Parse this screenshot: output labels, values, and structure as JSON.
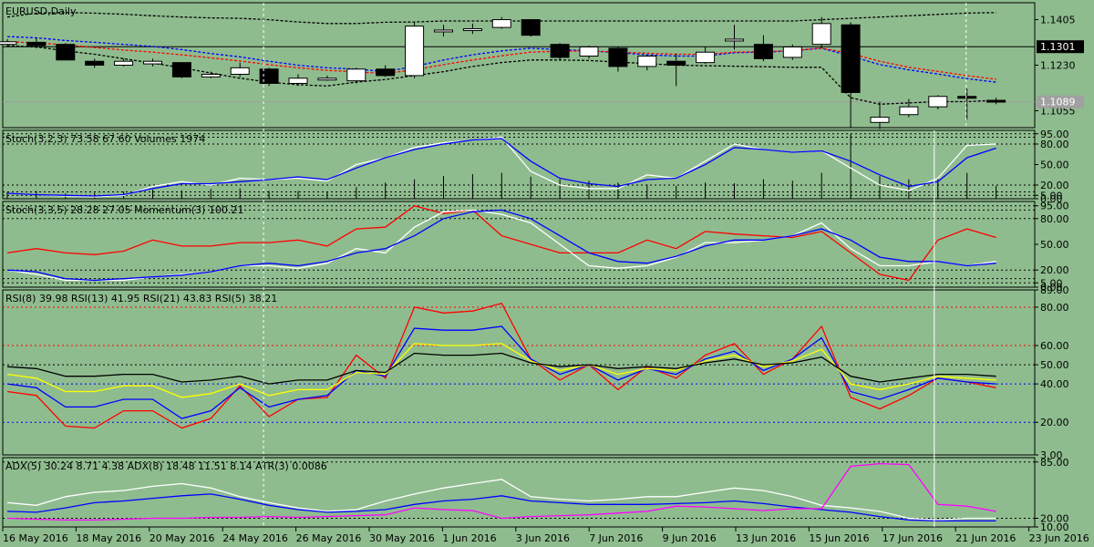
{
  "colors": {
    "background": "#8fbc8f",
    "bull_candle": "#ffffff",
    "bear_candle": "#000000",
    "blue": "#0000ff",
    "red": "#ff0000",
    "white": "#ffffff",
    "yellow": "#ffff00",
    "magenta": "#ff00ff",
    "grid_line": "#000000",
    "price_label_bg": "#000000",
    "bid_label_bg": "#a0a0a0"
  },
  "chart_data": [
    {
      "type": "candlestick",
      "title": "EURUSD,Daily",
      "y_ticks": [
        "1.1405",
        "1.1230",
        "1.1055"
      ],
      "ylim": [
        1.099,
        1.147
      ],
      "hline_label": "1.1301",
      "hline_value": 1.1301,
      "bid_label": "1.1089",
      "bid_value": 1.1089,
      "candles": [
        {
          "o": 1.131,
          "h": 1.133,
          "l": 1.13,
          "c": 1.132
        },
        {
          "o": 1.1318,
          "h": 1.1335,
          "l": 1.1295,
          "c": 1.1305
        },
        {
          "o": 1.131,
          "h": 1.1315,
          "l": 1.125,
          "c": 1.125
        },
        {
          "o": 1.1245,
          "h": 1.1255,
          "l": 1.122,
          "c": 1.123
        },
        {
          "o": 1.123,
          "h": 1.1255,
          "l": 1.1225,
          "c": 1.1245
        },
        {
          "o": 1.1235,
          "h": 1.1255,
          "l": 1.1225,
          "c": 1.1245
        },
        {
          "o": 1.124,
          "h": 1.124,
          "l": 1.118,
          "c": 1.1185
        },
        {
          "o": 1.1185,
          "h": 1.1205,
          "l": 1.118,
          "c": 1.1195
        },
        {
          "o": 1.1195,
          "h": 1.124,
          "l": 1.1185,
          "c": 1.122
        },
        {
          "o": 1.1215,
          "h": 1.122,
          "l": 1.115,
          "c": 1.116
        },
        {
          "o": 1.116,
          "h": 1.1195,
          "l": 1.115,
          "c": 1.118
        },
        {
          "o": 1.1175,
          "h": 1.119,
          "l": 1.117,
          "c": 1.118
        },
        {
          "o": 1.117,
          "h": 1.122,
          "l": 1.116,
          "c": 1.1215
        },
        {
          "o": 1.1215,
          "h": 1.123,
          "l": 1.1185,
          "c": 1.119
        },
        {
          "o": 1.119,
          "h": 1.1395,
          "l": 1.118,
          "c": 1.138
        },
        {
          "o": 1.136,
          "h": 1.1385,
          "l": 1.134,
          "c": 1.1365
        },
        {
          "o": 1.1365,
          "h": 1.139,
          "l": 1.135,
          "c": 1.137
        },
        {
          "o": 1.1375,
          "h": 1.1415,
          "l": 1.137,
          "c": 1.1405
        },
        {
          "o": 1.1405,
          "h": 1.1405,
          "l": 1.134,
          "c": 1.1345
        },
        {
          "o": 1.131,
          "h": 1.1315,
          "l": 1.125,
          "c": 1.126
        },
        {
          "o": 1.1265,
          "h": 1.1305,
          "l": 1.1255,
          "c": 1.13
        },
        {
          "o": 1.1295,
          "h": 1.13,
          "l": 1.1205,
          "c": 1.1225
        },
        {
          "o": 1.1225,
          "h": 1.127,
          "l": 1.121,
          "c": 1.1265
        },
        {
          "o": 1.1245,
          "h": 1.1275,
          "l": 1.115,
          "c": 1.123
        },
        {
          "o": 1.124,
          "h": 1.13,
          "l": 1.1235,
          "c": 1.128
        },
        {
          "o": 1.1325,
          "h": 1.1385,
          "l": 1.129,
          "c": 1.133
        },
        {
          "o": 1.131,
          "h": 1.1345,
          "l": 1.1245,
          "c": 1.1255
        },
        {
          "o": 1.126,
          "h": 1.131,
          "l": 1.125,
          "c": 1.13
        },
        {
          "o": 1.131,
          "h": 1.1415,
          "l": 1.1295,
          "c": 1.139
        },
        {
          "o": 1.1385,
          "h": 1.1395,
          "l": 1.099,
          "c": 1.1125
        },
        {
          "o": 1.101,
          "h": 1.109,
          "l": 1.0985,
          "c": 1.103
        },
        {
          "o": 1.104,
          "h": 1.11,
          "l": 1.103,
          "c": 1.107
        },
        {
          "o": 1.107,
          "h": 1.1115,
          "l": 1.106,
          "c": 1.111
        },
        {
          "o": 1.111,
          "h": 1.114,
          "l": 1.102,
          "c": 1.1105
        },
        {
          "o": 1.1095,
          "h": 1.1105,
          "l": 1.108,
          "c": 1.1089
        }
      ],
      "series": [
        {
          "color": "#0000ff",
          "dash": "dotted",
          "values": [
            1.134,
            1.1335,
            1.1325,
            1.1318,
            1.131,
            1.1302,
            1.129,
            1.1275,
            1.1262,
            1.1245,
            1.123,
            1.122,
            1.1215,
            1.1205,
            1.1225,
            1.125,
            1.127,
            1.1285,
            1.1295,
            1.129,
            1.1285,
            1.1278,
            1.127,
            1.1265,
            1.1265,
            1.1278,
            1.128,
            1.1285,
            1.1295,
            1.1265,
            1.1232,
            1.1212,
            1.1196,
            1.1178,
            1.1165
          ]
        },
        {
          "color": "#ff0000",
          "dash": "dotted",
          "values": [
            1.132,
            1.1316,
            1.1308,
            1.1298,
            1.1288,
            1.128,
            1.127,
            1.1258,
            1.1246,
            1.1232,
            1.122,
            1.121,
            1.1204,
            1.1198,
            1.1212,
            1.1232,
            1.125,
            1.1266,
            1.128,
            1.1284,
            1.1285,
            1.128,
            1.1276,
            1.1272,
            1.1272,
            1.128,
            1.1282,
            1.1286,
            1.1296,
            1.1275,
            1.1245,
            1.1222,
            1.1206,
            1.119,
            1.1176
          ]
        },
        {
          "color": "#000000",
          "dash": "dotted",
          "values": [
            1.1305,
            1.13,
            1.1285,
            1.1272,
            1.1255,
            1.1238,
            1.122,
            1.12,
            1.118,
            1.1165,
            1.1155,
            1.115,
            1.1165,
            1.1175,
            1.119,
            1.1205,
            1.1225,
            1.124,
            1.125,
            1.125,
            1.1248,
            1.1242,
            1.1236,
            1.123,
            1.1228,
            1.1226,
            1.1224,
            1.1222,
            1.1222,
            1.1105,
            1.108,
            1.1085,
            1.109,
            1.109,
            1.1095
          ]
        },
        {
          "color": "#000000",
          "dash": "dotted",
          "values": [
            1.1415,
            1.143,
            1.1432,
            1.143,
            1.1426,
            1.142,
            1.1415,
            1.1412,
            1.141,
            1.1405,
            1.1396,
            1.139,
            1.139,
            1.1395,
            1.1396,
            1.14,
            1.14,
            1.14,
            1.14,
            1.14,
            1.14,
            1.14,
            1.14,
            1.14,
            1.14,
            1.14,
            1.14,
            1.14,
            1.1405,
            1.141,
            1.1415,
            1.142,
            1.1425,
            1.143,
            1.1432
          ]
        }
      ],
      "date_labels": [
        "16 May 2016",
        "18 May 2016",
        "20 May 2016",
        "24 May 2016",
        "26 May 2016",
        "30 May 2016",
        "1 Jun 2016",
        "3 Jun 2016",
        "7 Jun 2016",
        "9 Jun 2016",
        "13 Jun 2016",
        "15 Jun 2016",
        "17 Jun 2016",
        "21 Jun 2016",
        "23 Jun 2016"
      ]
    },
    {
      "type": "line",
      "title": "Stoch(3,2,3) 73.58 67.60 Volumes 1974",
      "ylim": [
        0,
        100
      ],
      "y_ticks": [
        "95.00",
        "80.00",
        "50.00",
        "20.00",
        "5.00",
        "0.00"
      ],
      "levels": [
        95,
        90,
        80,
        20,
        10,
        5
      ],
      "volumes": [
        10,
        12,
        8,
        9,
        11,
        14,
        13,
        15,
        16,
        12,
        12,
        10,
        18,
        25,
        30,
        35,
        38,
        40,
        34,
        30,
        28,
        25,
        22,
        20,
        25,
        24,
        30,
        28,
        40,
        100,
        35,
        30,
        32,
        40,
        20
      ],
      "series": [
        {
          "name": "",
          "color": "#ffffff",
          "values": [
            8,
            6,
            4,
            3,
            5,
            18,
            25,
            20,
            30,
            28,
            30,
            26,
            50,
            60,
            75,
            82,
            86,
            90,
            40,
            20,
            15,
            15,
            35,
            30,
            55,
            80,
            72,
            68,
            70,
            45,
            20,
            12,
            30,
            78,
            80
          ]
        },
        {
          "name": "",
          "color": "#0000ff",
          "values": [
            8,
            6,
            5,
            4,
            6,
            15,
            22,
            22,
            25,
            28,
            32,
            28,
            45,
            60,
            72,
            80,
            86,
            88,
            55,
            30,
            22,
            18,
            28,
            30,
            50,
            75,
            72,
            68,
            70,
            55,
            35,
            18,
            25,
            60,
            74
          ]
        }
      ]
    },
    {
      "type": "line",
      "title": "Stoch(3,3,5) 28.28 27.05 Momentum(3) 100.21",
      "ylim": [
        0,
        100
      ],
      "y_ticks": [
        "95.00",
        "80.00",
        "50.00",
        "20.00",
        "5.00",
        "0.00"
      ],
      "levels": [
        95,
        90,
        80,
        20,
        10,
        5
      ],
      "series": [
        {
          "name": "",
          "color": "#ff0000",
          "values": [
            40,
            45,
            40,
            38,
            42,
            55,
            48,
            48,
            52,
            52,
            55,
            48,
            68,
            70,
            95,
            86,
            90,
            60,
            50,
            40,
            40,
            40,
            55,
            45,
            65,
            62,
            60,
            58,
            65,
            40,
            15,
            8,
            55,
            68,
            58
          ]
        },
        {
          "name": "",
          "color": "#ffffff",
          "values": [
            20,
            15,
            8,
            8,
            8,
            12,
            15,
            18,
            25,
            25,
            22,
            28,
            45,
            40,
            70,
            88,
            90,
            85,
            75,
            50,
            25,
            22,
            25,
            35,
            52,
            52,
            55,
            60,
            75,
            45,
            25,
            25,
            30,
            25,
            30
          ]
        },
        {
          "name": "",
          "color": "#0000ff",
          "values": [
            20,
            18,
            10,
            8,
            10,
            12,
            14,
            18,
            25,
            28,
            25,
            30,
            40,
            45,
            60,
            80,
            88,
            90,
            80,
            60,
            40,
            30,
            28,
            36,
            48,
            55,
            55,
            60,
            68,
            55,
            35,
            30,
            30,
            25,
            28
          ]
        }
      ]
    },
    {
      "type": "line",
      "title": "RSI(8) 39.98 RSI(13) 41.95 RSI(21) 43.83 RSI(5) 38.21",
      "ylim": [
        3,
        89
      ],
      "y_ticks": [
        "89.00",
        "80.00",
        "60.00",
        "50.00",
        "40.00",
        "20.00",
        "3.00"
      ],
      "levels": [
        80,
        60,
        50,
        40,
        20
      ],
      "series": [
        {
          "name": "",
          "color": "#ff0000",
          "values": [
            36,
            34,
            18,
            17,
            26,
            26,
            17,
            22,
            39,
            23,
            32,
            33,
            55,
            43,
            80,
            77,
            78,
            82,
            53,
            42,
            50,
            37,
            49,
            43,
            55,
            61,
            45,
            53,
            70,
            33,
            27,
            34,
            43,
            41,
            38
          ]
        },
        {
          "name": "",
          "color": "#0000ff",
          "values": [
            40,
            38,
            28,
            28,
            32,
            32,
            22,
            26,
            38,
            28,
            32,
            34,
            47,
            44,
            69,
            68,
            68,
            70,
            53,
            45,
            50,
            42,
            48,
            45,
            53,
            57,
            47,
            53,
            64,
            36,
            32,
            37,
            43,
            41,
            40
          ]
        },
        {
          "name": "",
          "color": "#ffff00",
          "values": [
            45,
            43,
            36,
            36,
            39,
            39,
            33,
            35,
            40,
            34,
            37,
            37,
            46,
            45,
            61,
            60,
            60,
            61,
            52,
            47,
            50,
            45,
            48,
            47,
            52,
            55,
            49,
            52,
            58,
            40,
            37,
            40,
            44,
            43,
            42
          ]
        },
        {
          "name": "",
          "color": "#000000",
          "values": [
            49,
            48,
            44,
            44,
            45,
            45,
            41,
            42,
            44,
            40,
            42,
            42,
            47,
            46,
            56,
            55,
            55,
            56,
            51,
            49,
            50,
            48,
            49,
            48,
            51,
            53,
            50,
            51,
            54,
            44,
            41,
            43,
            45,
            45,
            44
          ]
        }
      ]
    },
    {
      "type": "line",
      "title": "ADX(5) 30.24 8.71 4.38 ADX(8) 18.48 11.51 8.14 ATR(3) 0.0086",
      "ylim": [
        10,
        90
      ],
      "y_ticks": [
        "85.00",
        "20.00",
        "10.00"
      ],
      "levels": [
        85,
        20
      ],
      "series": [
        {
          "name": "",
          "color": "#ffffff",
          "values": [
            38,
            35,
            45,
            50,
            52,
            57,
            60,
            55,
            45,
            38,
            32,
            28,
            30,
            40,
            48,
            55,
            60,
            65,
            45,
            42,
            40,
            42,
            45,
            45,
            50,
            55,
            52,
            45,
            35,
            32,
            28,
            20,
            18,
            20,
            20
          ]
        },
        {
          "name": "",
          "color": "#0000ff",
          "values": [
            28,
            27,
            32,
            38,
            40,
            43,
            46,
            48,
            42,
            35,
            30,
            27,
            28,
            30,
            36,
            40,
            42,
            46,
            40,
            38,
            36,
            36,
            36,
            37,
            38,
            40,
            37,
            33,
            30,
            27,
            22,
            18,
            17,
            17,
            17
          ]
        },
        {
          "name": "",
          "color": "#ff00ff",
          "values": [
            20,
            19,
            18,
            18,
            19,
            20,
            20,
            21,
            21,
            22,
            21,
            22,
            23,
            24,
            32,
            30,
            29,
            20,
            22,
            23,
            24,
            26,
            28,
            34,
            33,
            31,
            29,
            31,
            31,
            80,
            83,
            82,
            36,
            34,
            28
          ]
        }
      ]
    }
  ]
}
